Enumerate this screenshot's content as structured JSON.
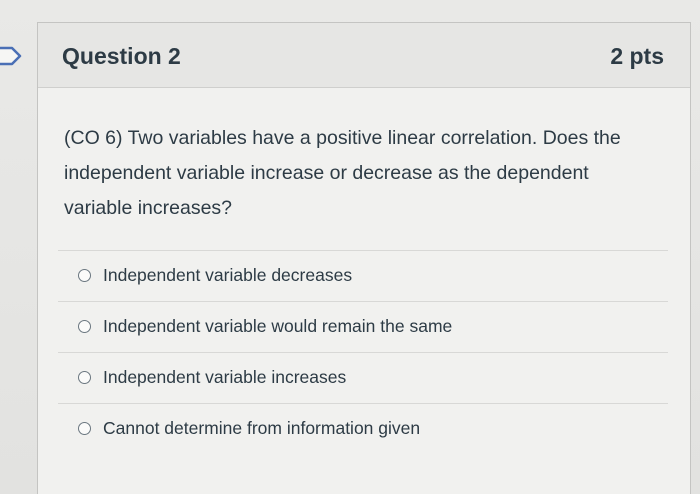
{
  "question": {
    "title": "Question 2",
    "points": "2 pts",
    "text": "(CO 6) Two variables have a positive linear correlation. Does the independent variable increase or decrease as the dependent variable increases?"
  },
  "answers": [
    {
      "label": "Independent variable decreases",
      "selected": false
    },
    {
      "label": "Independent variable would remain the same",
      "selected": false
    },
    {
      "label": "Independent variable increases",
      "selected": false
    },
    {
      "label": "Cannot determine from information given",
      "selected": false
    }
  ],
  "colors": {
    "text": "#2d3b45",
    "header_bg": "#e6e6e4",
    "card_bg": "#f1f1ef"
  },
  "icons": {
    "left_tab": "chevron-tab-icon",
    "radio": "radio-button-icon"
  }
}
